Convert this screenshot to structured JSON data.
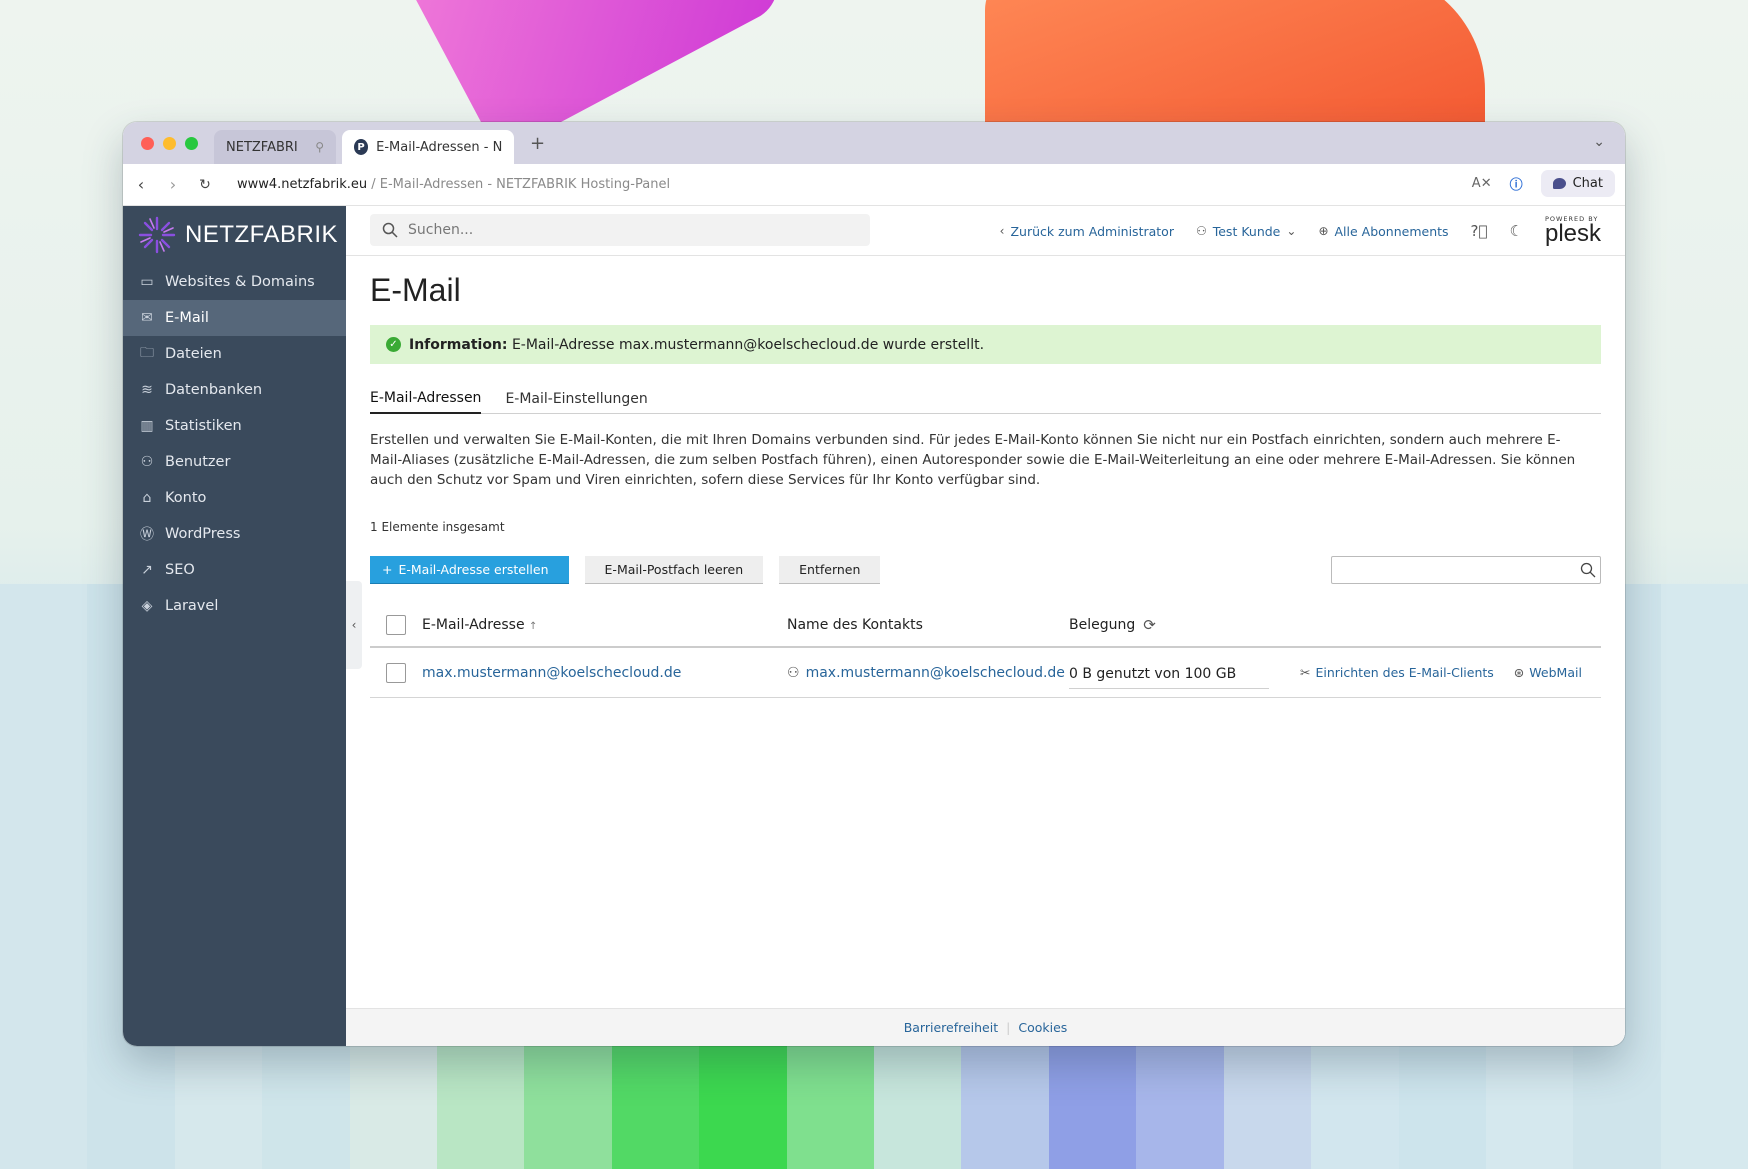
{
  "browser": {
    "tabs": [
      {
        "label": "NETZFABRIK"
      },
      {
        "label": "E-Mail-Adressen - NET"
      }
    ],
    "url_host": "www4.netzfabrik.eu",
    "url_path": " / E-Mail-Adressen - NETZFABRIK Hosting-Panel",
    "chat_label": "Chat",
    "traffic_colors": [
      "#ff5f57",
      "#febc2e",
      "#28c840"
    ]
  },
  "sidebar": {
    "brand": "NETZFABRIK",
    "items": [
      {
        "label": "Websites & Domains",
        "icon": "monitor-icon",
        "glyph": "▭"
      },
      {
        "label": "E-Mail",
        "icon": "mail-icon",
        "glyph": "✉"
      },
      {
        "label": "Dateien",
        "icon": "folder-icon",
        "glyph": "🗀"
      },
      {
        "label": "Datenbanken",
        "icon": "database-icon",
        "glyph": "≋"
      },
      {
        "label": "Statistiken",
        "icon": "chart-icon",
        "glyph": "▥"
      },
      {
        "label": "Benutzer",
        "icon": "user-icon",
        "glyph": "⚇"
      },
      {
        "label": "Konto",
        "icon": "account-icon",
        "glyph": "⌂"
      },
      {
        "label": "WordPress",
        "icon": "wordpress-icon",
        "glyph": "Ⓦ"
      },
      {
        "label": "SEO",
        "icon": "seo-icon",
        "glyph": "↗"
      },
      {
        "label": "Laravel",
        "icon": "laravel-icon",
        "glyph": "◈"
      }
    ],
    "active_index": 1
  },
  "topbar": {
    "search_placeholder": "Suchen...",
    "back_admin": "Zurück zum Administrator",
    "user": "Test Kunde",
    "subscriptions": "Alle Abonnements",
    "powered_by": "POWERED BY",
    "plesk": "plesk"
  },
  "page": {
    "title": "E-Mail",
    "info_label": "Information:",
    "info_text": " E-Mail-Adresse max.mustermann@koelschecloud.de wurde erstellt.",
    "tabs": [
      "E-Mail-Adressen",
      "E-Mail-Einstellungen"
    ],
    "description": "Erstellen und verwalten Sie E-Mail-Konten, die mit Ihren Domains verbunden sind. Für jedes E-Mail-Konto können Sie nicht nur ein Postfach einrichten, sondern auch mehrere E-Mail-Aliases (zusätzliche E-Mail-Adressen, die zum selben Postfach führen), einen Autoresponder sowie die E-Mail-Weiterleitung an eine oder mehrere E-Mail-Adressen. Sie können auch den Schutz vor Spam und Viren einrichten, sofern diese Services für Ihr Konto verfügbar sind.",
    "count": "1 Elemente insgesamt",
    "buttons": {
      "create": "E-Mail-Adresse erstellen",
      "empty": "E-Mail-Postfach leeren",
      "remove": "Entfernen"
    }
  },
  "table": {
    "headers": {
      "email": "E-Mail-Adresse",
      "contact": "Name des Kontakts",
      "usage": "Belegung"
    },
    "rows": [
      {
        "email": "max.mustermann@koelschecloud.de",
        "contact": "max.mustermann@koelschecloud.de",
        "usage": "0 B genutzt von 100 GB",
        "action_client": "Einrichten des E-Mail-Clients",
        "action_webmail": "WebMail"
      }
    ]
  },
  "footer": {
    "accessibility": "Barrierefreiheit",
    "cookies": "Cookies"
  },
  "colors": {
    "sidebar": "#3a4a5c",
    "sidebar_active": "#56677a",
    "primary": "#28a0de",
    "link": "#28659a",
    "info_bg": "#ddf4d2"
  }
}
